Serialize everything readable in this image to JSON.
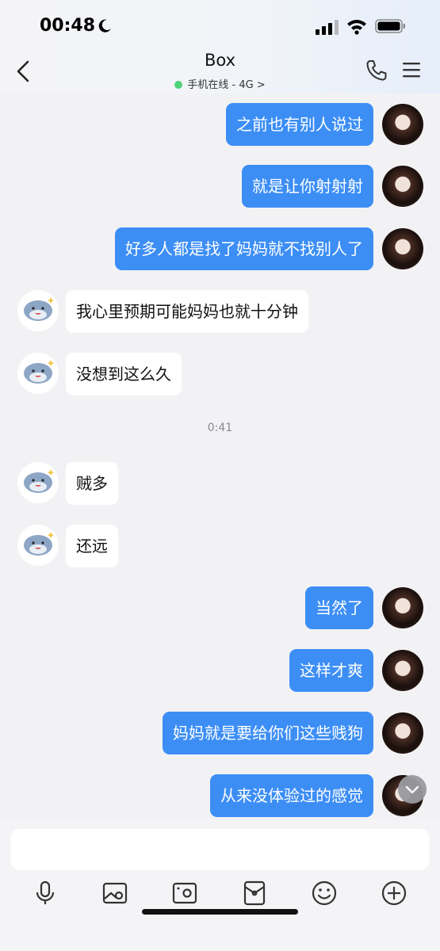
{
  "status_bar": {
    "time": "00:48"
  },
  "header": {
    "title": "Box",
    "subtitle": "手机在线 - 4G",
    "subtitle_chevron": ">",
    "online_color": "#4fd27a"
  },
  "chat": {
    "timestamp": "0:41",
    "messages": [
      {
        "from": "me",
        "text": "之前也有别人说过"
      },
      {
        "from": "me",
        "text": "就是让你射射射"
      },
      {
        "from": "me",
        "text": "好多人都是找了妈妈就不找别人了"
      },
      {
        "from": "other",
        "text": "我心里预期可能妈妈也就十分钟"
      },
      {
        "from": "other",
        "text": "没想到这么久"
      },
      {
        "from": "other",
        "text": "贼多"
      },
      {
        "from": "other",
        "text": "还远"
      },
      {
        "from": "me",
        "text": "当然了"
      },
      {
        "from": "me",
        "text": "这样才爽"
      },
      {
        "from": "me",
        "text": "妈妈就是要给你们这些贱狗"
      },
      {
        "from": "me",
        "text": "从来没体验过的感觉"
      }
    ]
  },
  "input": {
    "value": "",
    "placeholder": ""
  },
  "toolbar": [
    "microphone-icon",
    "image-icon",
    "camera-icon",
    "red-packet-icon",
    "emoji-icon",
    "plus-icon"
  ],
  "colors": {
    "outgoing_bubble": "#3c8ef5",
    "incoming_bubble": "#ffffff",
    "background": "#f2f2f5"
  }
}
